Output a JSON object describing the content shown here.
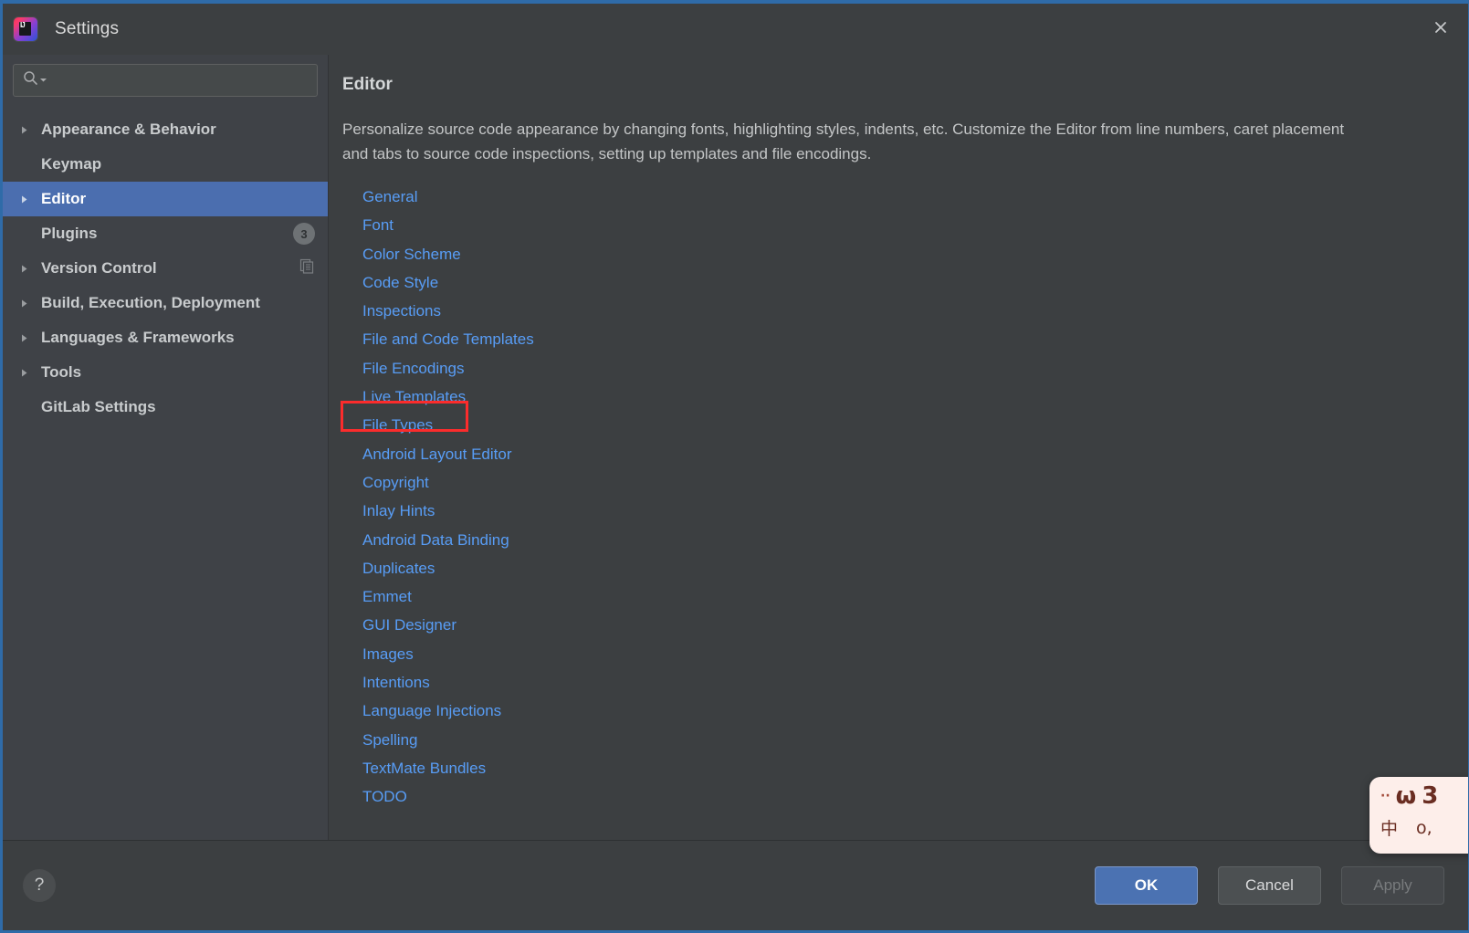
{
  "window": {
    "title": "Settings",
    "app_icon": "intellij-idea-icon",
    "close_icon": "close-icon",
    "accent_color": "#2f6ba8",
    "background": "#3c3f41",
    "sidebar_background": "#3f4247",
    "selection_color": "#4b6eaf",
    "link_color": "#589df6",
    "annotation_color": "#fb2c2c"
  },
  "search": {
    "icon": "search-icon",
    "dropdown_icon": "chevron-down-icon",
    "value": "",
    "placeholder": ""
  },
  "sidebar": {
    "items": [
      {
        "label": "Appearance & Behavior",
        "expandable": true,
        "selected": false
      },
      {
        "label": "Keymap",
        "expandable": false,
        "selected": false
      },
      {
        "label": "Editor",
        "expandable": true,
        "selected": true
      },
      {
        "label": "Plugins",
        "expandable": false,
        "selected": false,
        "badge": "3"
      },
      {
        "label": "Version Control",
        "expandable": true,
        "selected": false,
        "trailing_icon": "copy-icon"
      },
      {
        "label": "Build, Execution, Deployment",
        "expandable": true,
        "selected": false
      },
      {
        "label": "Languages & Frameworks",
        "expandable": true,
        "selected": false
      },
      {
        "label": "Tools",
        "expandable": true,
        "selected": false
      },
      {
        "label": "GitLab Settings",
        "expandable": false,
        "selected": false
      }
    ]
  },
  "main": {
    "title": "Editor",
    "description": "Personalize source code appearance by changing fonts, highlighting styles, indents, etc. Customize the Editor from line numbers, caret placement and tabs to source code inspections, setting up templates and file encodings.",
    "links": [
      {
        "label": "General",
        "hovered": false
      },
      {
        "label": "Font",
        "hovered": false
      },
      {
        "label": "Color Scheme",
        "hovered": false
      },
      {
        "label": "Code Style",
        "hovered": false
      },
      {
        "label": "Inspections",
        "hovered": false
      },
      {
        "label": "File and Code Templates",
        "hovered": false
      },
      {
        "label": "File Encodings",
        "hovered": false
      },
      {
        "label": "Live Templates",
        "hovered": false
      },
      {
        "label": "File Types",
        "hovered": true,
        "annotated": true
      },
      {
        "label": "Android Layout Editor",
        "hovered": false
      },
      {
        "label": "Copyright",
        "hovered": false
      },
      {
        "label": "Inlay Hints",
        "hovered": false
      },
      {
        "label": "Android Data Binding",
        "hovered": false
      },
      {
        "label": "Duplicates",
        "hovered": false
      },
      {
        "label": "Emmet",
        "hovered": false
      },
      {
        "label": "GUI Designer",
        "hovered": false
      },
      {
        "label": "Images",
        "hovered": false
      },
      {
        "label": "Intentions",
        "hovered": false
      },
      {
        "label": "Language Injections",
        "hovered": false
      },
      {
        "label": "Spelling",
        "hovered": false
      },
      {
        "label": "TextMate Bundles",
        "hovered": false
      },
      {
        "label": "TODO",
        "hovered": false
      }
    ]
  },
  "footer": {
    "help_label": "?",
    "ok_label": "OK",
    "cancel_label": "Cancel",
    "apply_label": "Apply",
    "apply_disabled": true
  },
  "floating_widget": {
    "line1": "ω",
    "line1_mark": "3",
    "line2_left": "中",
    "line2_right": "o,"
  }
}
